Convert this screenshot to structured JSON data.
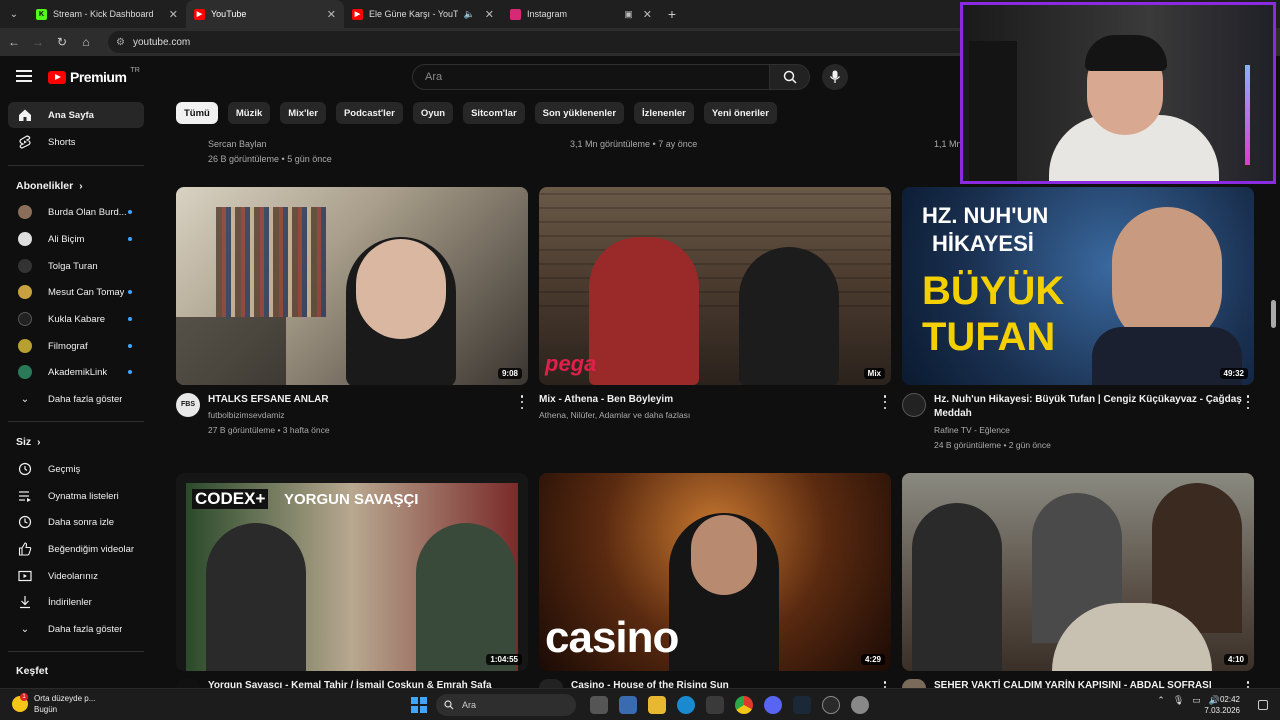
{
  "browser": {
    "tabs": [
      {
        "title": "Stream - Kick Dashboard",
        "icon": "kick-icon",
        "color": "#53fc18"
      },
      {
        "title": "YouTube",
        "icon": "youtube-icon",
        "color": "#ff0000",
        "active": true
      },
      {
        "title": "Ele Güne Karşı - YouTube",
        "icon": "youtube-icon",
        "color": "#ff0000"
      },
      {
        "title": "Instagram",
        "icon": "instagram-icon",
        "color": "#d62976"
      }
    ],
    "url": "youtube.com"
  },
  "masthead": {
    "logo_text": "Premium",
    "logo_region": "TR",
    "search_placeholder": "Ara"
  },
  "sidebar": {
    "main": [
      {
        "label": "Ana Sayfa",
        "icon": "home-icon",
        "active": true
      },
      {
        "label": "Shorts",
        "icon": "shorts-icon"
      }
    ],
    "subscriptions_title": "Abonelikler",
    "subscriptions": [
      {
        "label": "Burda Olan Burd...",
        "color": "#8a6e5a"
      },
      {
        "label": "Ali Biçim",
        "color": "#dddddd"
      },
      {
        "label": "Tolga Turan",
        "color": "#333333"
      },
      {
        "label": "Mesut Can Tomay",
        "color": "#c8a040"
      },
      {
        "label": "Kukla Kabare",
        "color": "#222222"
      },
      {
        "label": "Filmograf",
        "color": "#b8a030"
      },
      {
        "label": "AkademikLink",
        "color": "#2a7a5a"
      }
    ],
    "subs_more": "Daha fazla göster",
    "you_title": "Siz",
    "you": [
      {
        "label": "Geçmiş",
        "icon": "history-icon"
      },
      {
        "label": "Oynatma listeleri",
        "icon": "playlists-icon"
      },
      {
        "label": "Daha sonra izle",
        "icon": "watch-later-icon"
      },
      {
        "label": "Beğendiğim videolar",
        "icon": "like-icon"
      },
      {
        "label": "Videolarınız",
        "icon": "your-videos-icon"
      },
      {
        "label": "İndirilenler",
        "icon": "download-icon"
      }
    ],
    "you_more": "Daha fazla göster",
    "explore_title": "Keşfet"
  },
  "chips": [
    "Tümü",
    "Müzik",
    "Mix'ler",
    "Podcast'ler",
    "Oyun",
    "Sitcom'lar",
    "Son yüklenenler",
    "İzlenenler",
    "Yeni öneriler"
  ],
  "partial_row": [
    {
      "channel": "Sercan Baylan",
      "meta": "26 B görüntüleme • 5 gün önce"
    },
    {
      "meta": "3,1 Mn görüntüleme • 7 ay önce"
    },
    {
      "meta": "1,1 Mn"
    }
  ],
  "videos": [
    {
      "title": "HTALKS EFSANE ANLAR",
      "channel": "futbolbizimsevdamiz",
      "meta": "27 B görüntüleme • 3 hafta önce",
      "duration": "9:08"
    },
    {
      "title": "Mix - Athena - Ben Böyleyim",
      "channel": "Athena, Nilüfer, Adamlar ve daha fazlası",
      "meta": "",
      "duration": "Mix"
    },
    {
      "title": "Hz. Nuh'un Hikayesi: Büyük Tufan | Cengiz Küçükayvaz - Çağdaş Meddah",
      "channel": "Rafine TV - Eğlence",
      "meta": "24 B görüntüleme • 2 gün önce",
      "duration": "49:32"
    },
    {
      "title": "Yorgun Savaşçı - Kemal Tahir / İsmail Coşkun & Emrah Safa",
      "duration": "1:04:55"
    },
    {
      "title": "Casino - House of the Rising Sun",
      "duration": "4:29"
    },
    {
      "title": "SEHER VAKTİ ÇALDIM YARİN KAPISINI - ABDAL SOFRASI",
      "duration": "4:10"
    }
  ],
  "thumb_text": {
    "nuh_1": "HZ. NUH'UN",
    "nuh_2": "HİKAYESİ",
    "nuh_3": "BÜYÜK",
    "nuh_4": "TUFAN",
    "codex": "CODEX+",
    "codex_title": "YORGUN SAVAŞÇI",
    "casino": "casino",
    "pega": "pega",
    "fbs": "FBS"
  },
  "taskbar": {
    "weather_line1": "Orta düzeyde p...",
    "weather_line2": "Bugün",
    "search_placeholder": "Ara",
    "time": "02:42",
    "date": "7.03.2026",
    "weather_badge": "1"
  }
}
